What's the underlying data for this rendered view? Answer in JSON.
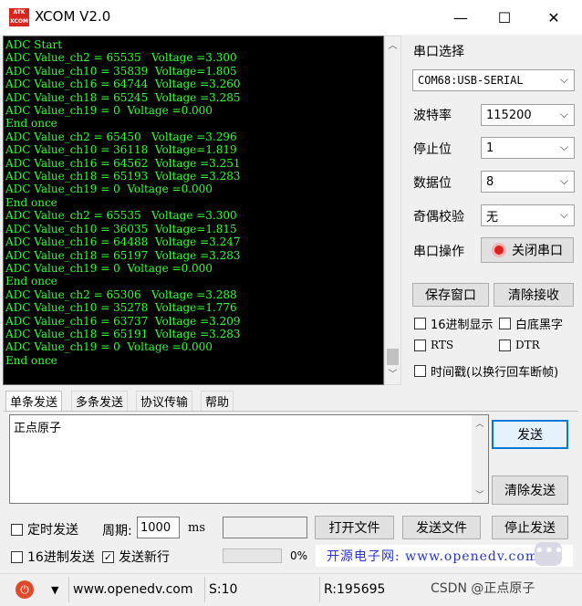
{
  "window": {
    "logo_text": "ATK\nXCOM",
    "title": "XCOM V2.0",
    "minimize_glyph": "—",
    "maximize_glyph": "☐",
    "close_glyph": "✕"
  },
  "terminal": {
    "lines": "ADC Start\nADC Value_ch2 = 65535   Voltage =3.300\nADC Value_ch10 = 35839  Voltage=1.805\nADC Value_ch16 = 64744  Voltage =3.260\nADC Value_ch18 = 65245  Voltage =3.285\nADC Value_ch19 = 0  Voltage =0.000\nEnd once\nADC Value_ch2 = 65450   Voltage =3.296\nADC Value_ch10 = 36118  Voltage=1.819\nADC Value_ch16 = 64562  Voltage =3.251\nADC Value_ch18 = 65193  Voltage =3.283\nADC Value_ch19 = 0  Voltage =0.000\nEnd once\nADC Value_ch2 = 65535   Voltage =3.300\nADC Value_ch10 = 36035  Voltage=1.815\nADC Value_ch16 = 64488  Voltage =3.247\nADC Value_ch18 = 65197  Voltage =3.283\nADC Value_ch19 = 0  Voltage =0.000\nEnd once\nADC Value_ch2 = 65306   Voltage =3.288\nADC Value_ch10 = 35278  Voltage=1.776\nADC Value_ch16 = 63737  Voltage =3.209\nADC Value_ch18 = 65191  Voltage =3.283\nADC Value_ch19 = 0  Voltage =0.000\nEnd once",
    "text_color": "#33ff33"
  },
  "settings": {
    "port_select_label": "串口选择",
    "port_value": "COM68:USB-SERIAL",
    "baud_label": "波特率",
    "baud_value": "115200",
    "stopbit_label": "停止位",
    "stopbit_value": "1",
    "databit_label": "数据位",
    "databit_value": "8",
    "parity_label": "奇偶校验",
    "parity_value": "无",
    "port_op_label": "串口操作",
    "close_port_label": "关闭串口",
    "save_window_label": "保存窗口",
    "clear_recv_label": "清除接收",
    "hex_display_label": "16进制显示",
    "white_bg_label": "白底黑字",
    "rts_label": "RTS",
    "dtr_label": "DTR",
    "timestamp_label": "时间戳(以换行回车断帧)"
  },
  "tabs": [
    "单条发送",
    "多条发送",
    "协议传输",
    "帮助"
  ],
  "send": {
    "text": "正点原子",
    "send_label": "发送",
    "clear_send_label": "清除发送"
  },
  "bottom": {
    "timed_send_label": "定时发送",
    "period_label": "周期:",
    "period_value": "1000",
    "period_unit": "ms",
    "open_file_label": "打开文件",
    "send_file_label": "发送文件",
    "stop_send_label": "停止发送",
    "hex_send_label": "16进制发送",
    "send_newline_label": "发送新行",
    "progress_percent_text": "0%",
    "progress_value": 0,
    "banner": "开源电子网: www.openedv.com"
  },
  "status": {
    "dropdown_glyph": "▼",
    "website": "www.openedv.com",
    "sent": "S:10",
    "received": "R:195695",
    "watermark": "CSDN @正点原子"
  },
  "colors": {
    "close_port_icon": "#e02020",
    "banner_text": "#2a33c7"
  }
}
